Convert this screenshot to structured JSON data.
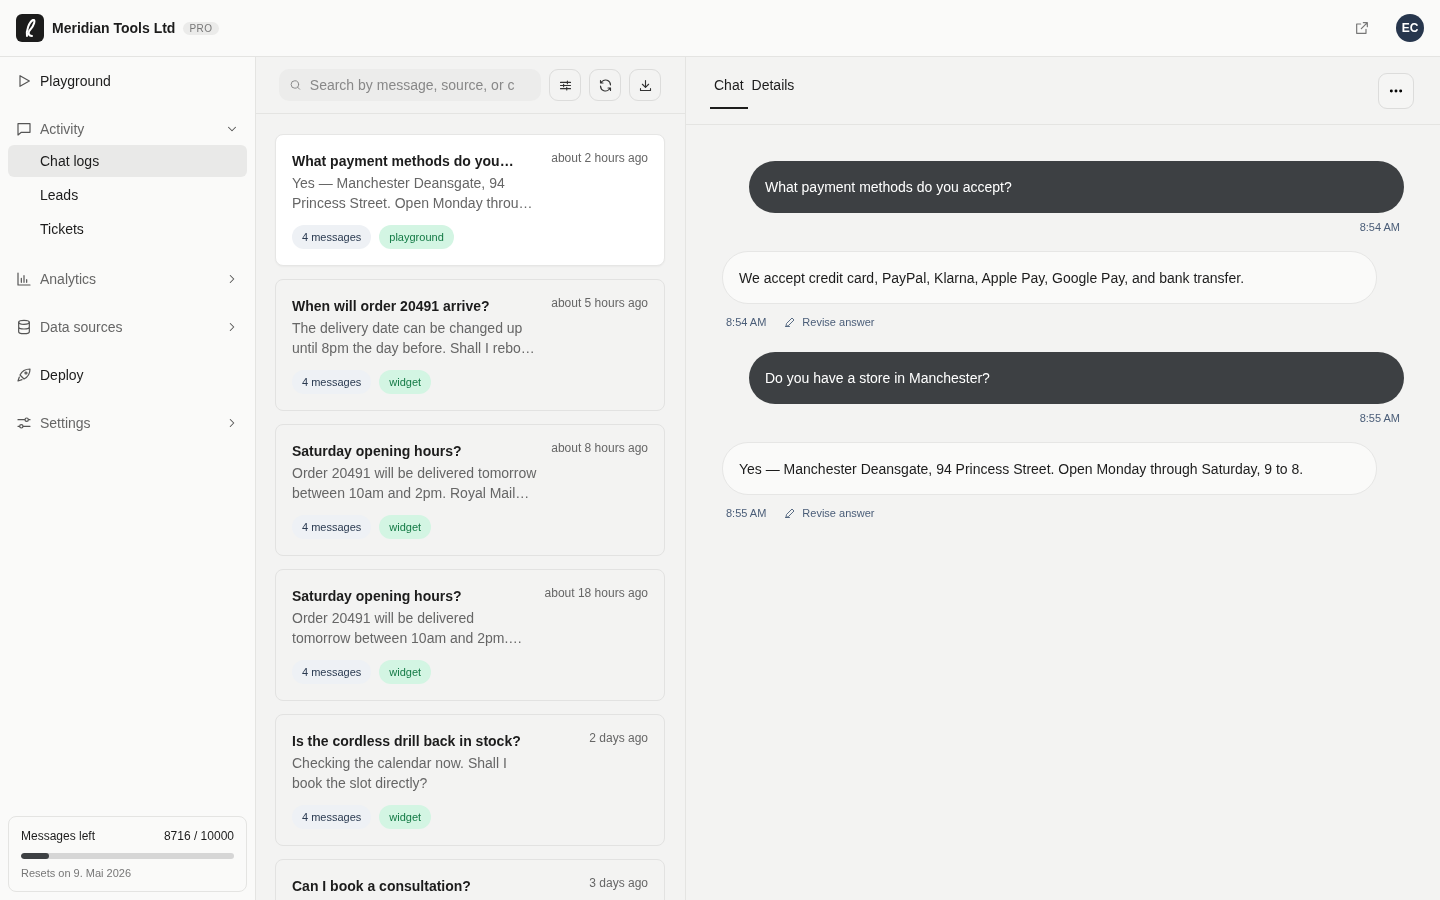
{
  "header": {
    "brand": "Meridian Tools Ltd",
    "plan": "PRO",
    "avatar": "EC"
  },
  "sidebar": {
    "items": [
      {
        "label": "Playground",
        "kind": "link",
        "selected": false
      },
      {
        "label": "Activity",
        "kind": "group",
        "expanded": true,
        "children": [
          {
            "label": "Chat logs",
            "selected": true
          },
          {
            "label": "Leads",
            "selected": false
          },
          {
            "label": "Tickets",
            "selected": false
          }
        ]
      },
      {
        "label": "Analytics",
        "kind": "group",
        "expanded": false
      },
      {
        "label": "Data sources",
        "kind": "group",
        "expanded": false
      },
      {
        "label": "Deploy",
        "kind": "link",
        "selected": false
      },
      {
        "label": "Settings",
        "kind": "group",
        "expanded": false
      }
    ],
    "usage": {
      "label": "Messages left",
      "count": "8716 / 10000",
      "level": 0.13,
      "note": "Resets on 9. Mai 2026"
    }
  },
  "conversations": {
    "search": {
      "placeholder": "Search by message, source, or c"
    },
    "items": [
      {
        "title": "What payment methods do you…",
        "time": "about 2 hours ago",
        "preview": "Yes — Manchester Deansgate, 94 Princess Street. Open Monday throu…",
        "messages": "4 messages",
        "source": "playground",
        "selected": true
      },
      {
        "title": "When will order 20491 arrive?",
        "time": "about 5 hours ago",
        "preview": "The delivery date can be changed up until 8pm the day before. Shall I rebo…",
        "messages": "4 messages",
        "source": "widget",
        "selected": false
      },
      {
        "title": "Saturday opening hours?",
        "time": "about 8 hours ago",
        "preview": "Order 20491 will be delivered tomorrow between 10am and 2pm. Royal Mail…",
        "messages": "4 messages",
        "source": "widget",
        "selected": false
      },
      {
        "title": "Saturday opening hours?",
        "time": "about 18 hours ago",
        "preview": "Order 20491 will be delivered tomorrow between 10am and 2pm.…",
        "messages": "4 messages",
        "source": "widget",
        "selected": false
      },
      {
        "title": "Is the cordless drill back in stock?",
        "time": "2 days ago",
        "preview": "Checking the calendar now. Shall I book the slot directly?",
        "messages": "4 messages",
        "source": "widget",
        "selected": false
      },
      {
        "title": "Can I book a consultation?",
        "time": "3 days ago",
        "selected": false
      }
    ]
  },
  "chat": {
    "tabs": [
      {
        "label": "Chat",
        "selected": true
      },
      {
        "label": "Details",
        "selected": false
      }
    ],
    "messages": [
      {
        "kind": "user",
        "text": "What payment methods do you accept?",
        "time": "8:54 AM"
      },
      {
        "kind": "assistant",
        "text": "We accept credit card, PayPal, Klarna, Apple Pay, Google Pay, and bank transfer.",
        "time": "8:54 AM",
        "action": "Revise answer"
      },
      {
        "kind": "user",
        "text": "Do you have a store in Manchester?",
        "time": "8:55 AM"
      },
      {
        "kind": "assistant",
        "text": "Yes — Manchester Deansgate, 94 Princess Street. Open Monday through Saturday, 9 to 8.",
        "time": "8:55 AM",
        "action": "Revise answer"
      }
    ]
  }
}
